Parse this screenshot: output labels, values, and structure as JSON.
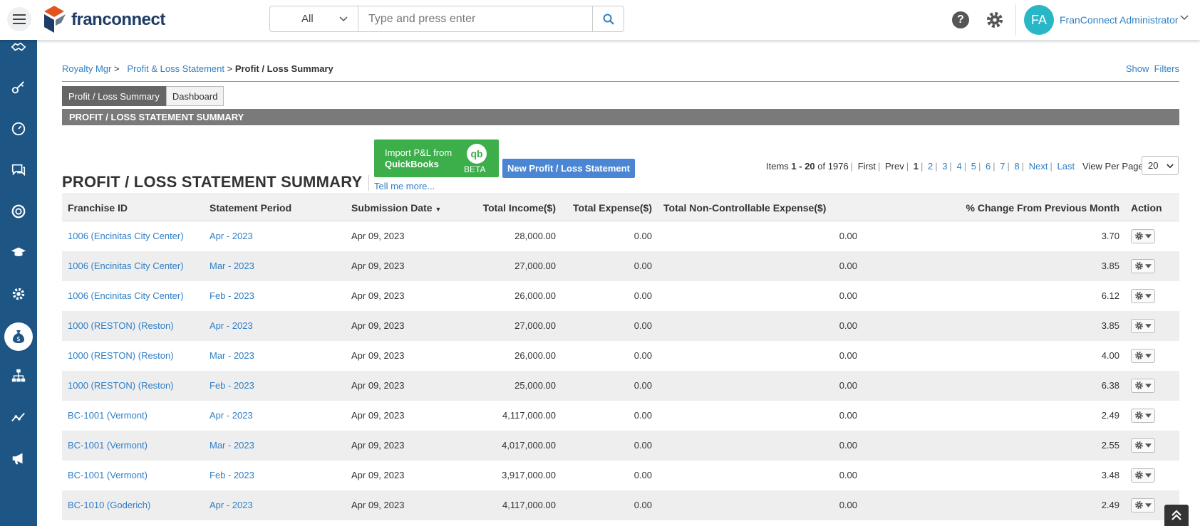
{
  "header": {
    "logo_text": "franconnect",
    "search_scope": "All",
    "search_placeholder": "Type and press enter",
    "avatar_initials": "FA",
    "user_name": "FranConnect Administrator"
  },
  "breadcrumb": {
    "items": [
      "Royalty Mgr",
      "Profit & Loss Statement"
    ],
    "current": "Profit / Loss Summary",
    "show_filters": "Show  Filters"
  },
  "tabs": [
    {
      "label": "Profit / Loss Summary",
      "active": true
    },
    {
      "label": "Dashboard",
      "active": false
    }
  ],
  "section_bar": "PROFIT / LOSS STATEMENT SUMMARY",
  "page_title": "PROFIT / LOSS STATEMENT SUMMARY",
  "tell_me": "Tell me more...",
  "quickbooks": {
    "line1": "Import P&L from",
    "line2": "QuickBooks",
    "logo": "qb",
    "badge": "BETA"
  },
  "new_button": "New Profit / Loss Statement",
  "pager": {
    "items_label": "Items",
    "range": "1 - 20",
    "of_label": "of 1976",
    "first": "First",
    "prev": "Prev",
    "current": "1",
    "pages": [
      "2",
      "3",
      "4",
      "5",
      "6",
      "7",
      "8"
    ],
    "next": "Next",
    "last": "Last",
    "view_per_page_label": "View Per Page",
    "view_per_page": "20"
  },
  "table": {
    "columns": [
      "Franchise ID",
      "Statement Period",
      "Submission Date",
      "Total Income($)",
      "Total Expense($)",
      "Total Non-Controllable Expense($)",
      "% Change From Previous Month",
      "Action"
    ],
    "rows": [
      {
        "franchise": "1006 (Encinitas City Center)",
        "period": "Apr - 2023",
        "date": "Apr 09, 2023",
        "income": "28,000.00",
        "expense": "0.00",
        "noncontrol": "0.00",
        "change": "3.70"
      },
      {
        "franchise": "1006 (Encinitas City Center)",
        "period": "Mar - 2023",
        "date": "Apr 09, 2023",
        "income": "27,000.00",
        "expense": "0.00",
        "noncontrol": "0.00",
        "change": "3.85"
      },
      {
        "franchise": "1006 (Encinitas City Center)",
        "period": "Feb - 2023",
        "date": "Apr 09, 2023",
        "income": "26,000.00",
        "expense": "0.00",
        "noncontrol": "0.00",
        "change": "6.12"
      },
      {
        "franchise": "1000 (RESTON) (Reston)",
        "period": "Apr - 2023",
        "date": "Apr 09, 2023",
        "income": "27,000.00",
        "expense": "0.00",
        "noncontrol": "0.00",
        "change": "3.85"
      },
      {
        "franchise": "1000 (RESTON) (Reston)",
        "period": "Mar - 2023",
        "date": "Apr 09, 2023",
        "income": "26,000.00",
        "expense": "0.00",
        "noncontrol": "0.00",
        "change": "4.00"
      },
      {
        "franchise": "1000 (RESTON) (Reston)",
        "period": "Feb - 2023",
        "date": "Apr 09, 2023",
        "income": "25,000.00",
        "expense": "0.00",
        "noncontrol": "0.00",
        "change": "6.38"
      },
      {
        "franchise": "BC-1001 (Vermont)",
        "period": "Apr - 2023",
        "date": "Apr 09, 2023",
        "income": "4,117,000.00",
        "expense": "0.00",
        "noncontrol": "0.00",
        "change": "2.49"
      },
      {
        "franchise": "BC-1001 (Vermont)",
        "period": "Mar - 2023",
        "date": "Apr 09, 2023",
        "income": "4,017,000.00",
        "expense": "0.00",
        "noncontrol": "0.00",
        "change": "2.55"
      },
      {
        "franchise": "BC-1001 (Vermont)",
        "period": "Feb - 2023",
        "date": "Apr 09, 2023",
        "income": "3,917,000.00",
        "expense": "0.00",
        "noncontrol": "0.00",
        "change": "3.48"
      },
      {
        "franchise": "BC-1010 (Goderich)",
        "period": "Apr - 2023",
        "date": "Apr 09, 2023",
        "income": "4,117,000.00",
        "expense": "0.00",
        "noncontrol": "0.00",
        "change": "2.49"
      }
    ]
  },
  "sidebar_icons": [
    "handshake-icon",
    "key-icon",
    "speedometer-icon",
    "chat-icon",
    "support-icon",
    "graduation-icon",
    "settings-icon",
    "money-bag-icon",
    "org-chart-icon",
    "analytics-icon",
    "megaphone-icon"
  ]
}
